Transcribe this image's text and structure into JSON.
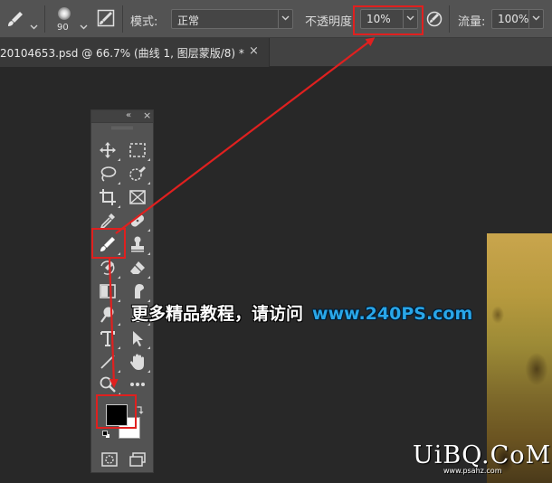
{
  "options_bar": {
    "brush_size": "90",
    "mode_label": "模式:",
    "mode_value": "正常",
    "opacity_label": "不透明度:",
    "opacity_value": "10%",
    "flow_label": "流量:",
    "flow_value": "100%",
    "icons": [
      "brush-tool-icon",
      "brush-preset-icon",
      "brush-settings-icon",
      "pressure-opacity-icon"
    ]
  },
  "document_tab": {
    "title": "20104653.psd @ 66.7% (曲线 1, 图层蒙版/8) *",
    "close": "×"
  },
  "toolbar": {
    "tools": [
      {
        "name": "move-tool-icon"
      },
      {
        "name": "marquee-tool-icon"
      },
      {
        "name": "lasso-tool-icon"
      },
      {
        "name": "quick-selection-tool-icon"
      },
      {
        "name": "crop-tool-icon"
      },
      {
        "name": "frame-tool-icon"
      },
      {
        "name": "eyedropper-tool-icon"
      },
      {
        "name": "healing-brush-tool-icon"
      },
      {
        "name": "brush-tool-icon",
        "selected": true
      },
      {
        "name": "clone-stamp-tool-icon"
      },
      {
        "name": "history-brush-tool-icon"
      },
      {
        "name": "eraser-tool-icon"
      },
      {
        "name": "gradient-tool-icon"
      },
      {
        "name": "smudge-tool-icon"
      },
      {
        "name": "dodge-tool-icon"
      },
      {
        "name": "pen-tool-icon"
      },
      {
        "name": "type-tool-icon"
      },
      {
        "name": "path-selection-tool-icon"
      },
      {
        "name": "line-tool-icon"
      },
      {
        "name": "hand-tool-icon"
      },
      {
        "name": "zoom-tool-icon"
      },
      {
        "name": "more-tools-icon"
      }
    ],
    "foreground_color": "#000000",
    "background_color": "#ffffff"
  },
  "watermark": {
    "text_cn": "更多精品教程，请访问",
    "text_url": "www.240PS.com",
    "logo": "UiBQ.CoM",
    "small": "www.psahz.com"
  },
  "colors": {
    "annotation_red": "#e0201f",
    "panel_gray": "#535353",
    "canvas_dark": "#282828",
    "watermark_blue": "#29a6e8"
  }
}
